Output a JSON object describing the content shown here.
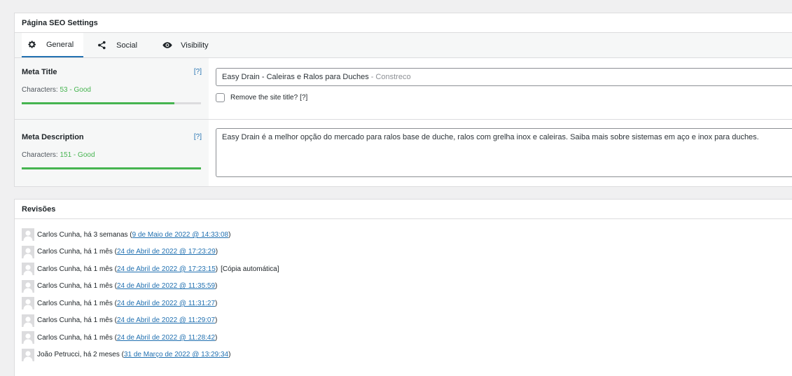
{
  "seo_box": {
    "title": "Página SEO Settings",
    "tabs": [
      {
        "label": "General",
        "icon": "gear-icon"
      },
      {
        "label": "Social",
        "icon": "share-icon"
      },
      {
        "label": "Visibility",
        "icon": "eye-icon"
      }
    ],
    "meta_title": {
      "label": "Meta Title",
      "help": "[?]",
      "chars_prefix": "Characters:",
      "chars_value": "53 - Good",
      "progress": 0.85,
      "value": "Easy Drain - Caleiras e Ralos para Duches",
      "suffix": "- Constreco",
      "remove_site_title_label": "Remove the site title?",
      "remove_help": "[?]"
    },
    "meta_description": {
      "label": "Meta Description",
      "help": "[?]",
      "chars_prefix": "Characters:",
      "chars_value": "151 - Good",
      "progress": 1.0,
      "value": "Easy Drain é a melhor opção do mercado para ralos base de duche, ralos com grelha inox e caleiras. Saiba mais sobre sistemas em aço e inox para duches."
    }
  },
  "revisions": {
    "title": "Revisões",
    "items": [
      {
        "author": "Carlos Cunha, há 3 semanas",
        "link": "9 de Maio de 2022 @ 14:33:08",
        "note": ""
      },
      {
        "author": "Carlos Cunha, há 1 mês",
        "link": "24 de Abril de 2022 @ 17:23:29",
        "note": ""
      },
      {
        "author": "Carlos Cunha, há 1 mês",
        "link": "24 de Abril de 2022 @ 17:23:15",
        "note": "[Cópia automática]"
      },
      {
        "author": "Carlos Cunha, há 1 mês",
        "link": "24 de Abril de 2022 @ 11:35:59",
        "note": ""
      },
      {
        "author": "Carlos Cunha, há 1 mês",
        "link": "24 de Abril de 2022 @ 11:31:27",
        "note": ""
      },
      {
        "author": "Carlos Cunha, há 1 mês",
        "link": "24 de Abril de 2022 @ 11:29:07",
        "note": ""
      },
      {
        "author": "Carlos Cunha, há 1 mês",
        "link": "24 de Abril de 2022 @ 11:28:42",
        "note": ""
      },
      {
        "author": "João Petrucci, há 2 meses",
        "link": "31 de Março de 2022 @ 13:29:34",
        "note": ""
      }
    ]
  },
  "colors": {
    "accent": "#2271b1",
    "good": "#46b450"
  }
}
